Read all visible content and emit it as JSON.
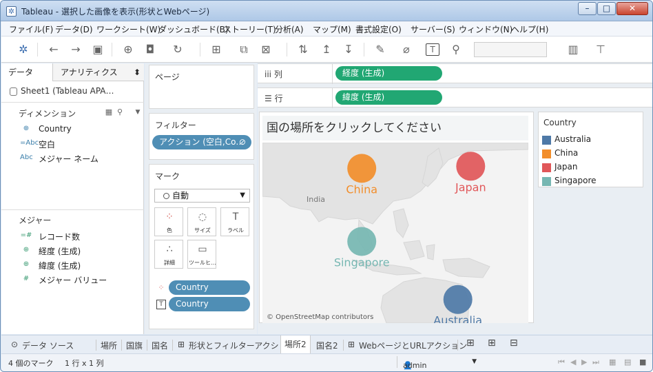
{
  "window": {
    "title": "Tableau - 選択した画像を表示(形状とWebページ)",
    "minimize_glyph": "–",
    "maximize_glyph": "□",
    "close_glyph": "✕"
  },
  "menu": [
    "ファイル(F)",
    "データ(D)",
    "ワークシート(W)",
    "ダッシュボード(B)",
    "ストーリー(T)",
    "分析(A)",
    "マップ(M)",
    "書式設定(O)",
    "サーバー(S)",
    "ウィンドウ(N)",
    "ヘルプ(H)"
  ],
  "toolbar_icons": [
    "tableau-logo-icon",
    "back-icon",
    "forward-icon",
    "save-icon",
    "new-datasource-icon",
    "pause-updates-icon",
    "refresh-icon",
    "new-worksheet-icon",
    "duplicate-sheet-icon",
    "clear-sheet-icon",
    "swap-rows-columns-icon",
    "sort-ascending-icon",
    "sort-descending-icon",
    "highlight-icon",
    "group-members-icon",
    "show-labels-icon",
    "pin-icon",
    "fit-dropdown",
    "show-me-icon",
    "presentation-mode-icon"
  ],
  "sidebar": {
    "tab_data": "データ",
    "tab_analytics": "アナリティクス",
    "datasource": "Sheet1 (Tableau APA…",
    "dimensions_label": "ディメンション",
    "dimensions": [
      {
        "icon": "globe-icon",
        "glyph": "⊕",
        "name": "Country"
      },
      {
        "icon": "string-icon",
        "glyph": "=Abc",
        "name": "空白"
      },
      {
        "icon": "string-icon",
        "glyph": "Abc",
        "name": "メジャー ネーム"
      }
    ],
    "measures_label": "メジャー",
    "measures": [
      {
        "icon": "number-icon",
        "glyph": "=#",
        "name": "レコード数"
      },
      {
        "icon": "globe-icon",
        "glyph": "⊕",
        "name": "経度 (生成)"
      },
      {
        "icon": "globe-icon",
        "glyph": "⊕",
        "name": "緯度 (生成)"
      },
      {
        "icon": "number-icon",
        "glyph": "#",
        "name": "メジャー バリュー"
      }
    ]
  },
  "pages_label": "ページ",
  "filters_label": "フィルター",
  "filter_pill": "アクション (空白,Co…",
  "marks": {
    "label": "マーク",
    "type": "自動",
    "buttons": [
      {
        "label": "色",
        "icon": "color-icon",
        "glyph": "⁘"
      },
      {
        "label": "サイズ",
        "icon": "size-icon",
        "glyph": "◌"
      },
      {
        "label": "ラベル",
        "icon": "label-icon",
        "glyph": "T"
      },
      {
        "label": "詳細",
        "icon": "detail-icon",
        "glyph": "∴"
      },
      {
        "label": "ツールヒ…",
        "icon": "tooltip-icon",
        "glyph": "▭"
      }
    ],
    "encodings": [
      {
        "icon": "color-icon",
        "glyph": "⁘",
        "field": "Country"
      },
      {
        "icon": "label-icon",
        "glyph": "T",
        "field": "Country"
      }
    ]
  },
  "shelves": {
    "columns_label": "列",
    "columns_pill": "経度 (生成)",
    "rows_label": "行",
    "rows_pill": "緯度 (生成)"
  },
  "view": {
    "title": "国の場所をクリックしてください",
    "attribution": "© OpenStreetMap contributors",
    "region_label": "India"
  },
  "chart_data": {
    "type": "scatter",
    "title": "国の場所をクリックしてください",
    "points": [
      {
        "country": "China",
        "longitude": 104,
        "latitude": 35,
        "color": "#f28e2b"
      },
      {
        "country": "Japan",
        "longitude": 138,
        "latitude": 36,
        "color": "#e15759"
      },
      {
        "country": "Singapore",
        "longitude": 104,
        "latitude": 1,
        "color": "#76b7b2"
      },
      {
        "country": "Australia",
        "longitude": 134,
        "latitude": -26,
        "color": "#4e79a7"
      }
    ]
  },
  "legend": {
    "title": "Country",
    "items": [
      {
        "label": "Australia",
        "color": "#4e79a7"
      },
      {
        "label": "China",
        "color": "#f28e2b"
      },
      {
        "label": "Japan",
        "color": "#e15759"
      },
      {
        "label": "Singapore",
        "color": "#76b7b2"
      }
    ]
  },
  "sheet_tabs": [
    {
      "label": "データ ソース",
      "icon": "datasource-icon",
      "glyph": "⊙",
      "active": false
    },
    {
      "label": "場所",
      "active": false
    },
    {
      "label": "国旗",
      "active": false
    },
    {
      "label": "国名",
      "active": false
    },
    {
      "label": "形状とフィルターアクション",
      "icon": "dashboard-icon",
      "glyph": "⊞",
      "active": false
    },
    {
      "label": "場所2",
      "active": true
    },
    {
      "label": "国名2",
      "active": false
    },
    {
      "label": "WebページとURLアクション",
      "icon": "dashboard-icon",
      "glyph": "⊞",
      "active": false
    }
  ],
  "status": {
    "marks": "4 個のマーク",
    "dims": "1 行 x 1 列",
    "user": "admin"
  },
  "colors": {
    "green_pill": "#21a773",
    "blue_pill": "#4f8eb5"
  }
}
